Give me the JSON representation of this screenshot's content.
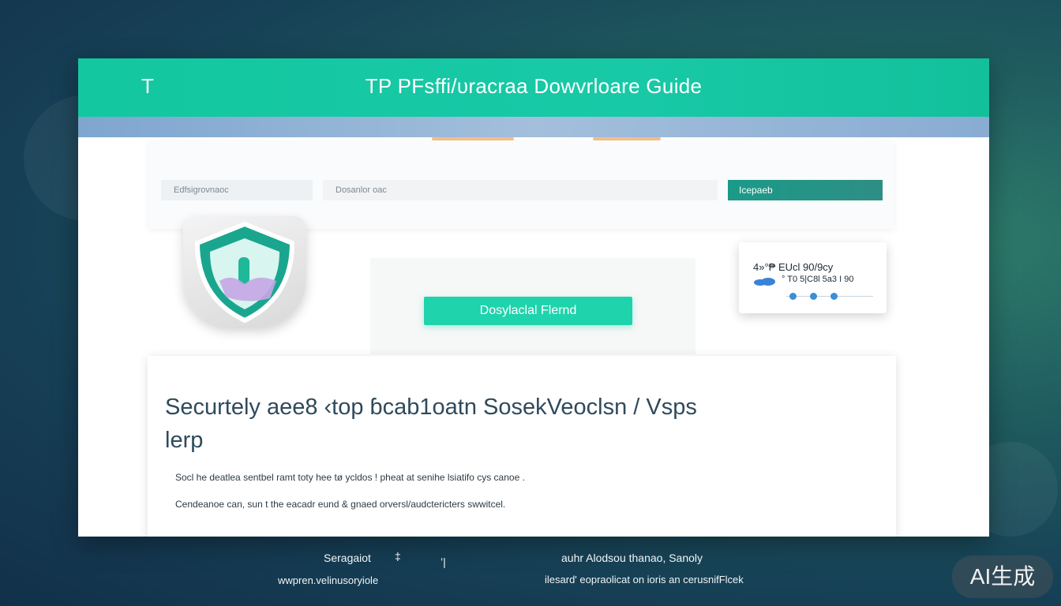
{
  "window": {
    "title_letter": "T",
    "title": "TP  PFsffi/υracraa Dowvrloare Guide"
  },
  "search": {
    "field1_placeholder": "Edfsigrovnaoc",
    "field2_placeholder": "Dosanlor  oac",
    "button_label": "Icepaeb"
  },
  "download": {
    "button_label": "Dosylaclal Flernd"
  },
  "info_card": {
    "line1": "4»°₱   EUcl 90/9cy",
    "line2": "° T0  5|C8l 5a3 I 90",
    "cloud_icon": "cloud-icon",
    "slider_level": 0.5
  },
  "content": {
    "headline": "Securtely aee8 ‹top  ɓcab1oatn SosekVeoclsn /  Vsps lerp",
    "paragraph1": "Socl he deatlea  sentbel ramt toty  hee  tø  ycldos  ! pheat at senihe lsiatifo cys canoe .",
    "paragraph2": "Cendeanoe  can, sun t  the  eacadr  eund  &  gnaed  orversl/audctericters  swwitcel."
  },
  "footer": {
    "left_line1": "Seragaiot",
    "left_icon1": "‡",
    "left_icon2": "’|",
    "left_line2": "wwpren.velinusoryiole",
    "right_line1": "auhr  Alodsou thanao,  Sanoly",
    "right_line2": "ilesard' eopraolicat on  ioris an  cerusnifFlcek"
  },
  "watermark": "AI生成",
  "colors": {
    "accent": "#1fd3ac",
    "title_bar": "#18c9a7",
    "search_button": "#2e8e85"
  }
}
